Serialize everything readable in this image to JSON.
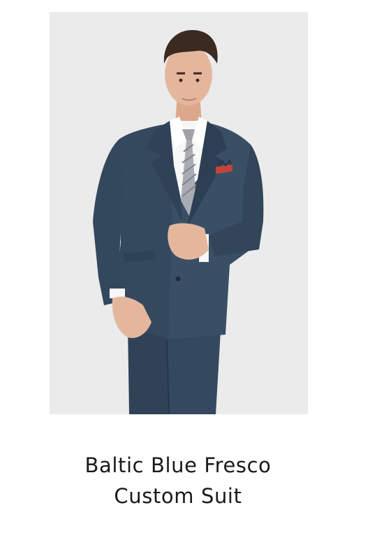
{
  "product": {
    "image_alt": "Baltic Blue Fresco Custom Suit",
    "title_line_1": "Baltic Blue Fresco",
    "title_line_2": "Custom Suit"
  },
  "colors": {
    "background": "#ffffff",
    "photo_backdrop": "#ebebeb",
    "suit": "#3a4f66",
    "suit_shadow": "#2c3e52",
    "shirt": "#f7f7f7",
    "tie": "#a9adb3",
    "skin": "#e4b79d",
    "hair": "#3b2a20",
    "pocket_square": "#c2453b",
    "title_text": "#1a1a1a"
  }
}
